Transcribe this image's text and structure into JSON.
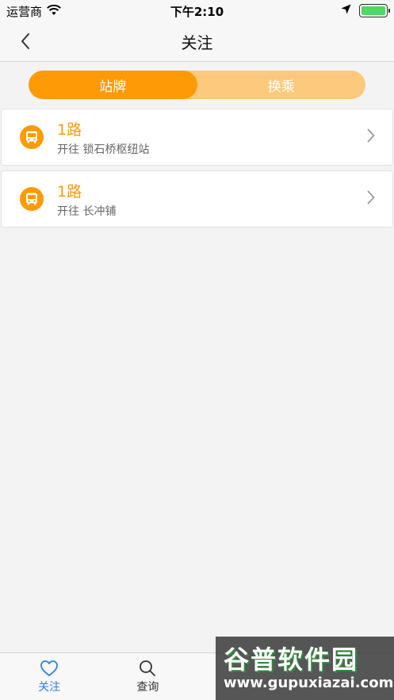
{
  "status_bar": {
    "carrier": "运营商",
    "time": "下午2:10"
  },
  "nav": {
    "title": "关注"
  },
  "segment": {
    "tabs": [
      {
        "label": "站牌",
        "active": true
      },
      {
        "label": "换乘",
        "active": false
      }
    ]
  },
  "favorites": [
    {
      "route": "1路",
      "destination": "开往 锁石桥枢纽站"
    },
    {
      "route": "1路",
      "destination": "开往 长冲铺"
    }
  ],
  "tab_bar": {
    "items": [
      {
        "label": "关注",
        "icon": "heart-icon",
        "active": true
      },
      {
        "label": "查询",
        "icon": "search-icon",
        "active": false
      }
    ]
  },
  "watermark": {
    "logo": "谷普软件园",
    "url": "www.gupuxiazai.com"
  },
  "colors": {
    "accent": "#fe9a05",
    "accent_light": "#fcc97d",
    "tab_active": "#2b7de9",
    "battery": "#4cd964"
  }
}
